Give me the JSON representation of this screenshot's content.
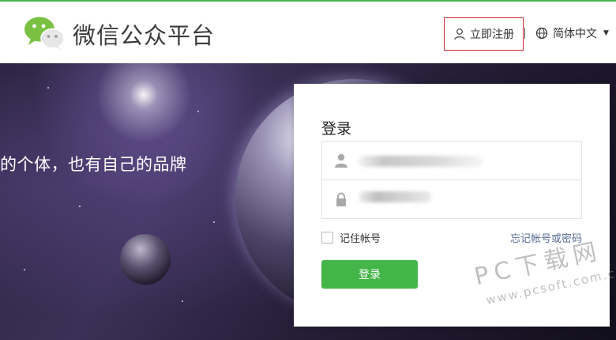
{
  "header": {
    "brand_title": "微信公众平台",
    "register_label": "立即注册",
    "language_label": "简体中文"
  },
  "banner": {
    "slogan": "的个体，也有自己的品牌"
  },
  "login": {
    "title": "登录",
    "remember_label": "记住帐号",
    "forgot_label": "忘记帐号或密码",
    "submit_label": "登录"
  },
  "watermark": {
    "site_name": "PC下载网",
    "url": "www.pcsoft.com.cn"
  },
  "colors": {
    "accent": "#44b549",
    "register_border": "#d0272b",
    "link": "#576b95"
  },
  "icons": {
    "logo": "wechat-logo",
    "register": "user-icon",
    "language": "globe-icon",
    "username": "user-icon",
    "password": "lock-icon"
  }
}
